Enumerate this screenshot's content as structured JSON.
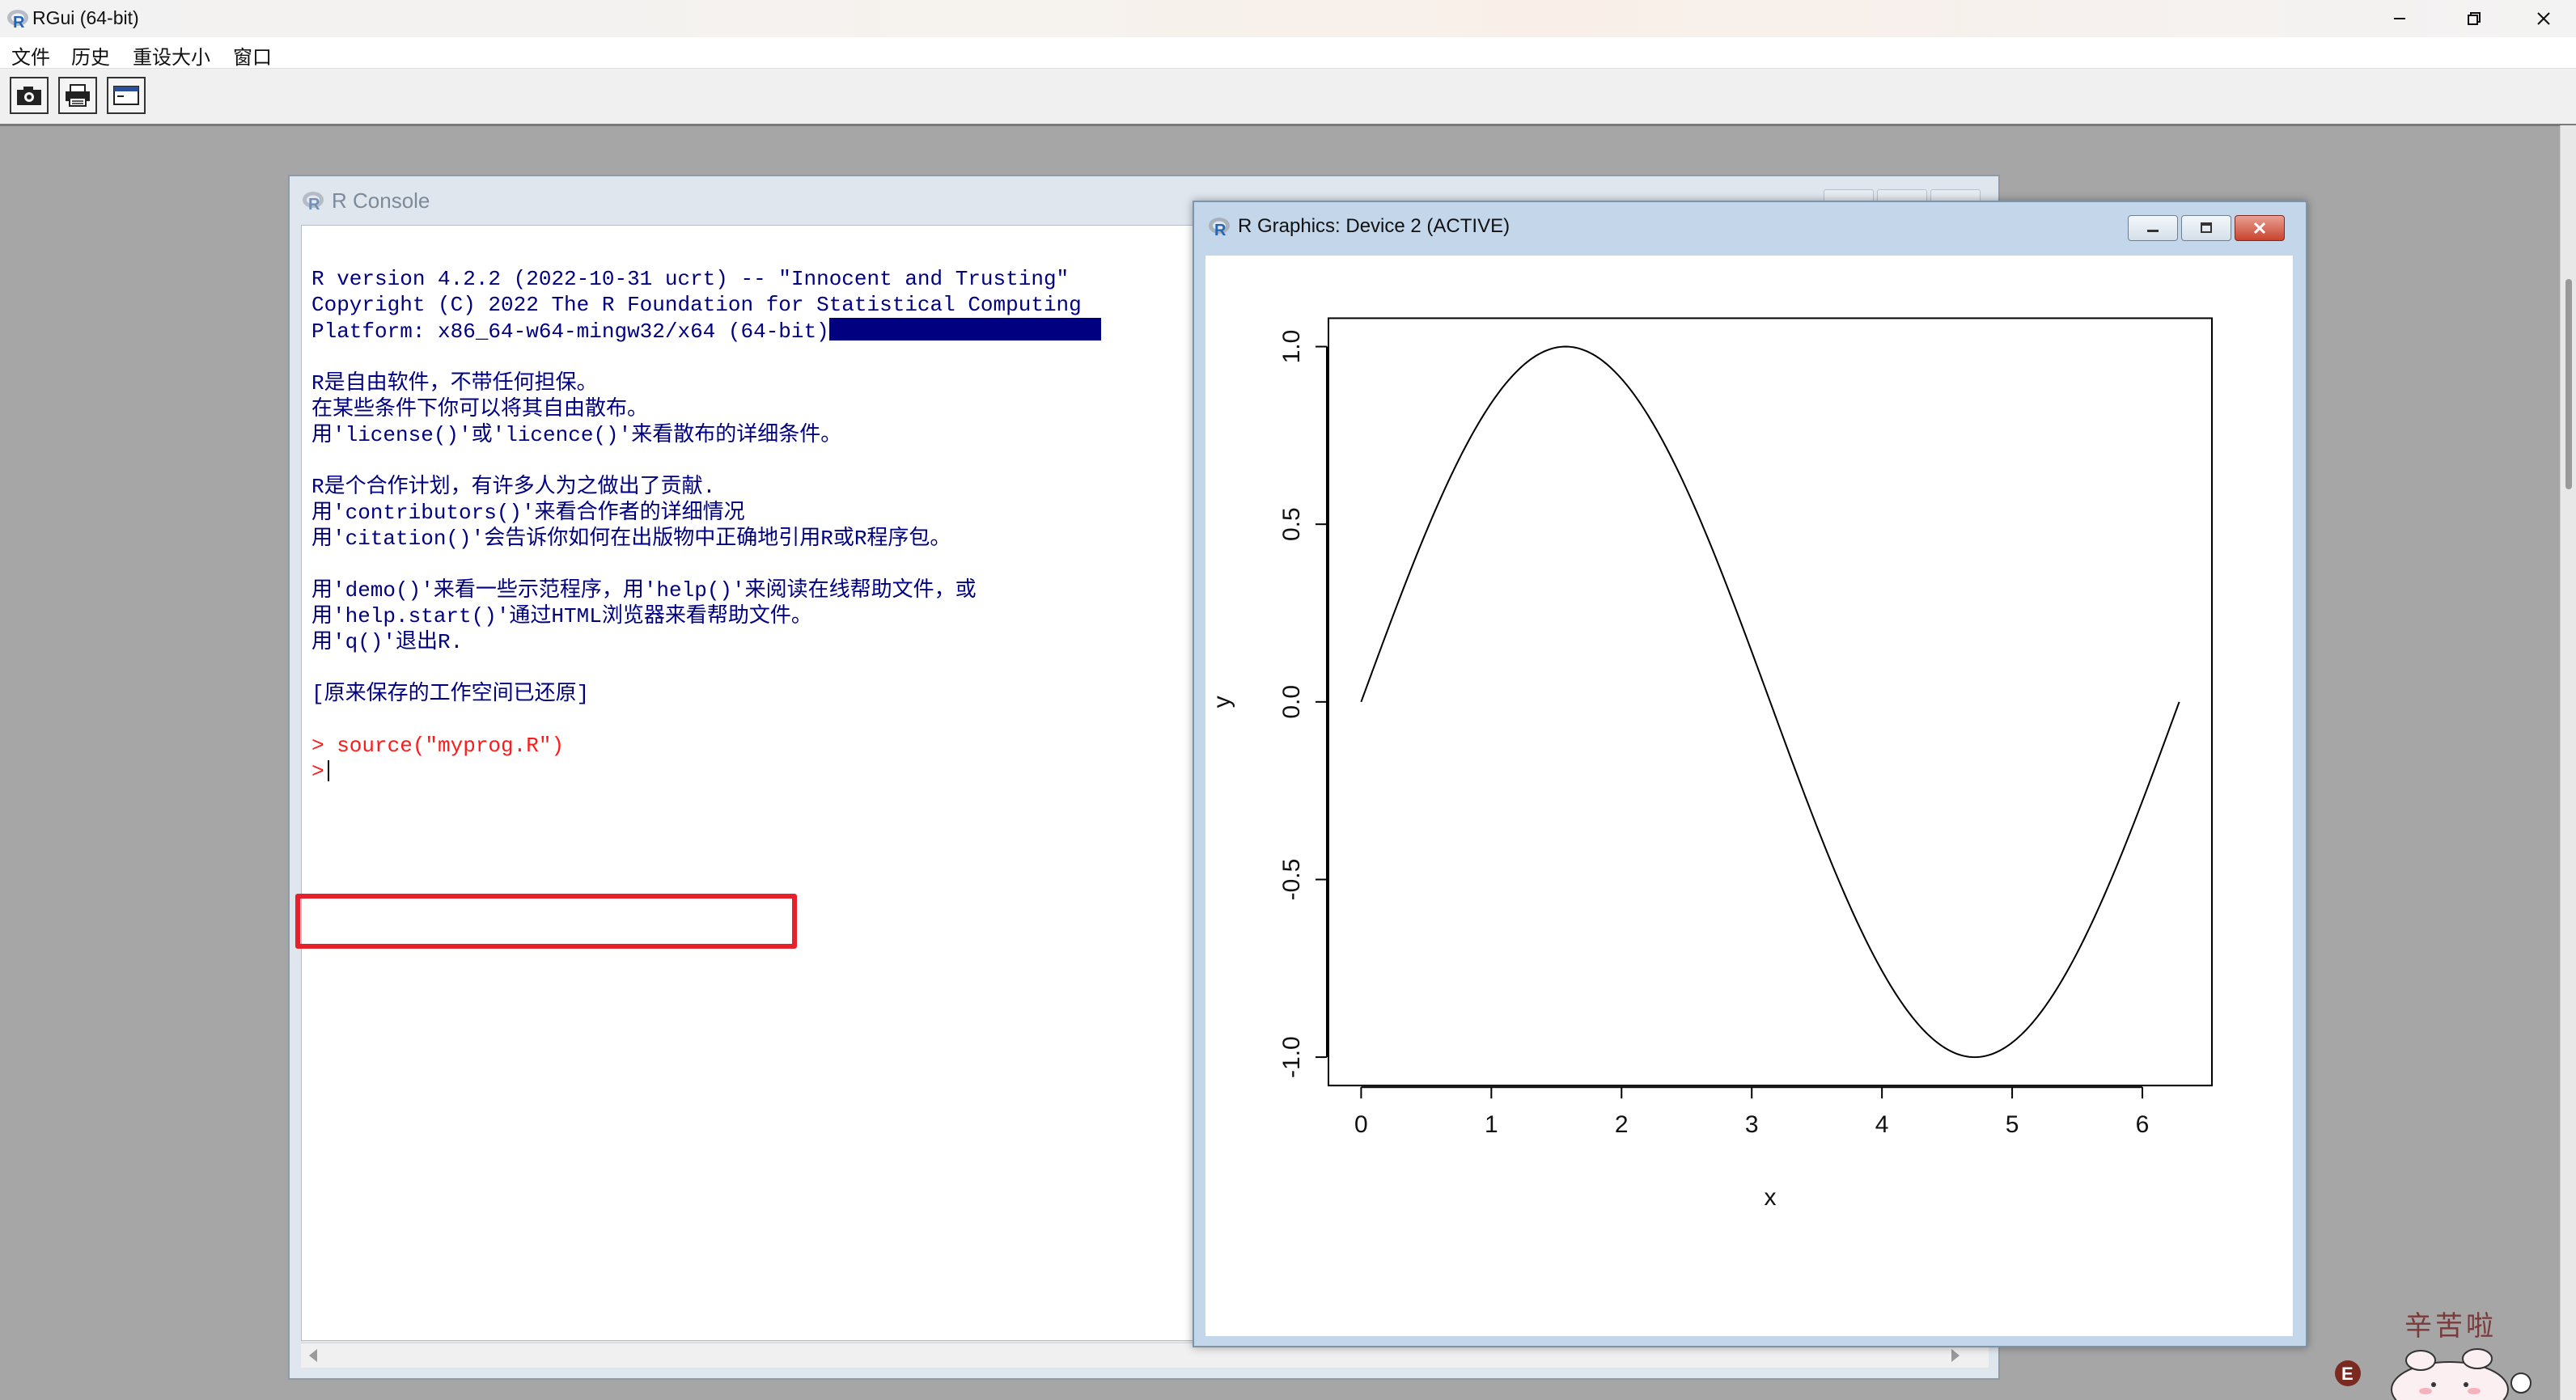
{
  "app": {
    "title": "RGui (64-bit)"
  },
  "menu": [
    {
      "label": "文件"
    },
    {
      "label": "历史"
    },
    {
      "label": "重设大小"
    },
    {
      "label": "窗口"
    }
  ],
  "console": {
    "title": "R Console",
    "lines": [
      "R version 4.2.2 (2022-10-31 ucrt) -- \"Innocent and Trusting\"",
      "Copyright (C) 2022 The R Foundation for Statistical Computing",
      "Platform: x86_64-w64-mingw32/x64 (64-bit)",
      "",
      "R是自由软件，不带任何担保。",
      "在某些条件下你可以将其自由散布。",
      "用'license()'或'licence()'来看散布的详细条件。",
      "",
      "R是个合作计划，有许多人为之做出了贡献.",
      "用'contributors()'来看合作者的详细情况",
      "用'citation()'会告诉你如何在出版物中正确地引用R或R程序包。",
      "",
      "用'demo()'来看一些示范程序，用'help()'来阅读在线帮助文件，或",
      "用'help.start()'通过HTML浏览器来看帮助文件。",
      "用'q()'退出R.",
      "",
      "[原来保存的工作空间已还原]",
      ""
    ],
    "command": "> source(\"myprog.R\")",
    "prompt": ">"
  },
  "graphics": {
    "title": "R Graphics: Device 2 (ACTIVE)"
  },
  "chart_data": {
    "type": "line",
    "title": "",
    "xlabel": "x",
    "ylabel": "y",
    "xlim": [
      0,
      6.2832
    ],
    "ylim": [
      -1,
      1
    ],
    "x_ticks": [
      "0",
      "1",
      "2",
      "3",
      "4",
      "5",
      "6"
    ],
    "y_ticks": [
      "-1.0",
      "-0.5",
      "0.0",
      "0.5",
      "1.0"
    ],
    "x_tick_values": [
      0,
      1,
      2,
      3,
      4,
      5,
      6
    ],
    "y_tick_values": [
      -1,
      -0.5,
      0,
      0.5,
      1
    ],
    "series": [
      {
        "x": [
          0,
          0.3307,
          0.6614,
          0.9921,
          1.3228,
          1.6535,
          1.9842,
          2.3149,
          2.6456,
          2.9762,
          3.3069,
          3.6376,
          3.9683,
          4.299,
          4.6297,
          4.9604,
          5.2911,
          5.6218,
          5.9525,
          6.2832
        ],
        "values": [
          0,
          0.3247,
          0.6142,
          0.8372,
          0.9694,
          0.9966,
          0.9158,
          0.7357,
          0.4759,
          0.1646,
          -0.1646,
          -0.4759,
          -0.7357,
          -0.9158,
          -0.9966,
          -0.9694,
          -0.8372,
          -0.6142,
          -0.3247,
          0
        ]
      }
    ],
    "colors": {
      "line": "#000000"
    }
  },
  "watermark": {
    "text": "辛苦啦"
  }
}
